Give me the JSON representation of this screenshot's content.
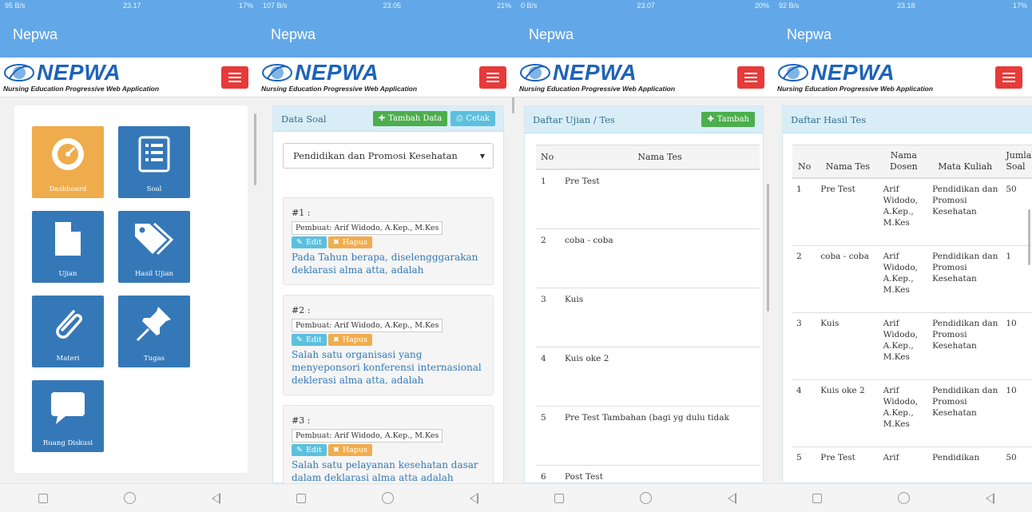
{
  "app_title": "Nepwa",
  "brand": {
    "name": "NEPWA",
    "tagline": "Nursing Education Progressive Web Application"
  },
  "phones": [
    {
      "status": {
        "left": "95 B/s",
        "time": "23.17",
        "battery": "17%"
      }
    },
    {
      "status": {
        "left": "107 B/s",
        "time": "23.05",
        "battery": "21%"
      }
    },
    {
      "status": {
        "left": "0 B/s",
        "time": "23.07",
        "battery": "20%"
      }
    },
    {
      "status": {
        "left": "92 B/s",
        "time": "23.18",
        "battery": "17%"
      }
    }
  ],
  "dashboard": {
    "tiles": [
      {
        "label": "Dashboard",
        "icon": "gauge-icon"
      },
      {
        "label": "Soal",
        "icon": "list-icon"
      },
      {
        "label": "Ujian",
        "icon": "document-icon"
      },
      {
        "label": "Hasil Ujian",
        "icon": "tags-icon"
      },
      {
        "label": "Materi",
        "icon": "paperclip-icon"
      },
      {
        "label": "Tugas",
        "icon": "pin-icon"
      },
      {
        "label": "Ruang Diskusi",
        "icon": "chat-icon"
      }
    ]
  },
  "soal": {
    "title": "Data Soal",
    "add_label": "Tambah Data",
    "print_label": "Cetak",
    "selected_course": "Pendidikan dan Promosi Kesehatan",
    "edit_label": "Edit",
    "delete_label": "Hapus",
    "questions": [
      {
        "num": "#1 :",
        "author": "Pembuat: Arif Widodo, A.Kep., M.Kes",
        "text": "Pada Tahun berapa, diselengggarakan deklarasi alma atta, adalah"
      },
      {
        "num": "#2 :",
        "author": "Pembuat: Arif Widodo, A.Kep., M.Kes",
        "text": "Salah satu organisasi yang menyeponsori konferensi internasional deklerasi alma atta, adalah"
      },
      {
        "num": "#3 :",
        "author": "Pembuat: Arif Widodo, A.Kep., M.Kes",
        "text": "Salah satu pelayanan kesehatan dasar dalam deklarasi alma atta adalah"
      }
    ]
  },
  "ujian": {
    "title": "Daftar Ujian / Tes",
    "add_label": "Tambah",
    "columns": [
      "No",
      "Nama Tes"
    ],
    "rows": [
      [
        "1",
        "Pre Test"
      ],
      [
        "2",
        "coba - coba"
      ],
      [
        "3",
        "Kuis"
      ],
      [
        "4",
        "Kuis oke 2"
      ],
      [
        "5",
        "Pre Test Tambahan (bagi yg dulu tidak"
      ],
      [
        "6",
        "Post Test"
      ]
    ]
  },
  "hasil": {
    "title": "Daftar Hasil Tes",
    "columns": [
      "No",
      "Nama Tes",
      "Nama Dosen",
      "Mata Kuliah",
      "Jumlah Soal"
    ],
    "rows": [
      [
        "1",
        "Pre Test",
        "Arif Widodo, A.Kep., M.Kes",
        "Pendidikan dan Promosi Kesehatan",
        "50"
      ],
      [
        "2",
        "coba - coba",
        "Arif Widodo, A.Kep., M.Kes",
        "Pendidikan dan Promosi Kesehatan",
        "1"
      ],
      [
        "3",
        "Kuis",
        "Arif Widodo, A.Kep., M.Kes",
        "Pendidikan dan Promosi Kesehatan",
        "10"
      ],
      [
        "4",
        "Kuis oke 2",
        "Arif Widodo, A.Kep., M.Kes",
        "Pendidikan dan Promosi Kesehatan",
        "10"
      ],
      [
        "5",
        "Pre Test",
        "Arif",
        "Pendidikan",
        "50"
      ]
    ]
  }
}
